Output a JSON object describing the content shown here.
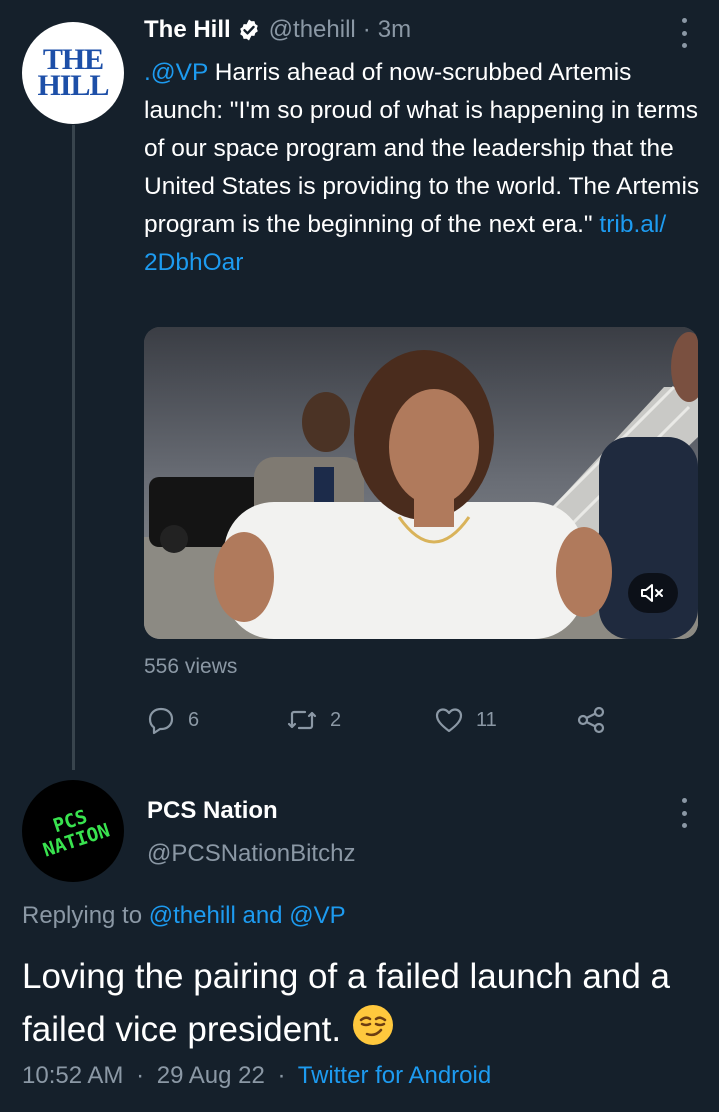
{
  "tweet": {
    "author_name": "The Hill",
    "verified": true,
    "handle": "@thehill",
    "separator": "·",
    "time": "3m",
    "avatar_text": [
      "THE",
      "HILL"
    ],
    "mention": ".@VP",
    "text": " Harris ahead of now-scrubbed Artemis launch: \"I'm so proud of what is happening in terms of our space program and the leadership that the United States is providing to the world. The Artemis program is the beginning of the next era.\" ",
    "link": "trib.al/ 2DbhOar",
    "media_label": "video-thumbnail",
    "views": "556 views",
    "actions": {
      "replies": "6",
      "retweets": "2",
      "likes": "11"
    }
  },
  "reply": {
    "author_name": "PCS Nation",
    "handle": "@PCSNationBitchz",
    "avatar_text": [
      "PCS",
      "NATION"
    ],
    "replying_prefix": "Replying to ",
    "replying_users": "@thehill and @VP",
    "text": "Loving the pairing of a failed launch and a failed vice president. ",
    "emoji": "smirk-emoji",
    "time": "10:52 AM",
    "date": "29 Aug 22",
    "source": "Twitter for Android"
  },
  "colors": {
    "background": "#15202b",
    "link": "#1d9bf0",
    "muted": "#8b98a5",
    "thread_line": "#38444d"
  }
}
